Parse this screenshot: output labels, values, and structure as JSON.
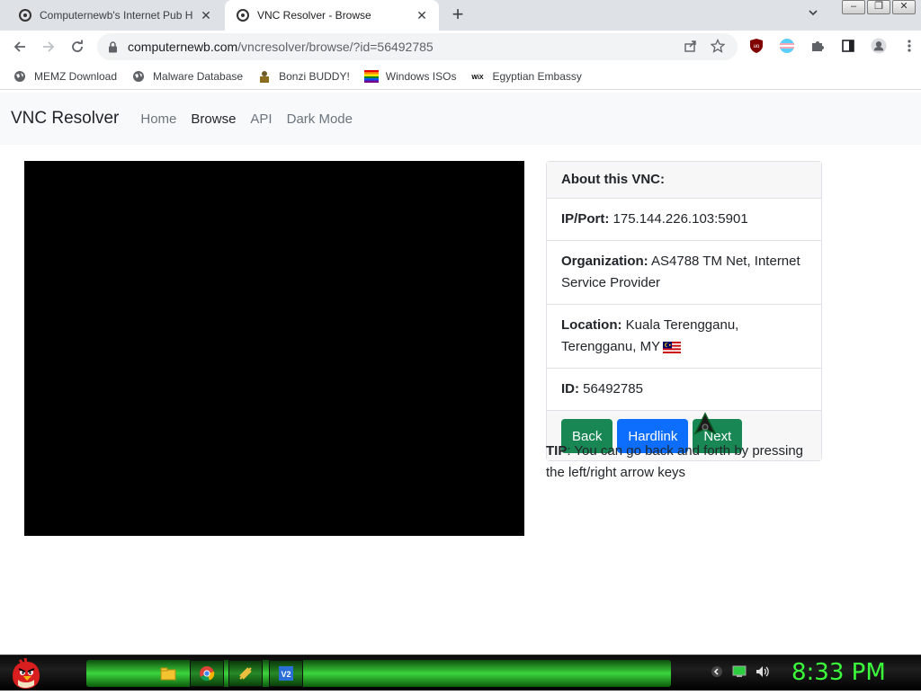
{
  "browser": {
    "tabs": [
      {
        "title": "Computernewb's Internet Pub H",
        "active": false
      },
      {
        "title": "VNC Resolver - Browse",
        "active": true
      }
    ],
    "url_host": "computernewb.com",
    "url_path": "/vncresolver/browse/?id=56492785",
    "bookmarks": [
      {
        "label": "MEMZ Download",
        "icon": "globe-icon"
      },
      {
        "label": "Malware Database",
        "icon": "globe-icon"
      },
      {
        "label": "Bonzi BUDDY!",
        "icon": "bonzi-icon"
      },
      {
        "label": "Windows ISOs",
        "icon": "rainbow-icon"
      },
      {
        "label": "Egyptian Embassy",
        "icon": "wix-icon"
      }
    ]
  },
  "navbar": {
    "brand": "VNC Resolver",
    "links": [
      "Home",
      "Browse",
      "API",
      "Dark Mode"
    ],
    "active_link": "Browse"
  },
  "card": {
    "header": "About this VNC:",
    "ip_label": "IP/Port:",
    "ip_value": "175.144.226.103:5901",
    "org_label": "Organization:",
    "org_value": "AS4788 TM Net, Internet Service Provider",
    "loc_label": "Location:",
    "loc_value": "Kuala Terengganu, Terengganu, MY",
    "id_label": "ID:",
    "id_value": "56492785",
    "buttons": {
      "back": "Back",
      "hardlink": "Hardlink",
      "next": "Next"
    }
  },
  "tip": {
    "label": "TIP",
    "text": ": You can go back and forth by pressing the left/right arrow keys"
  },
  "taskbar": {
    "clock": "8:33 PM"
  },
  "colors": {
    "btn_green": "#198754",
    "btn_blue": "#0d6efd",
    "clock_green": "#3cff3c"
  }
}
